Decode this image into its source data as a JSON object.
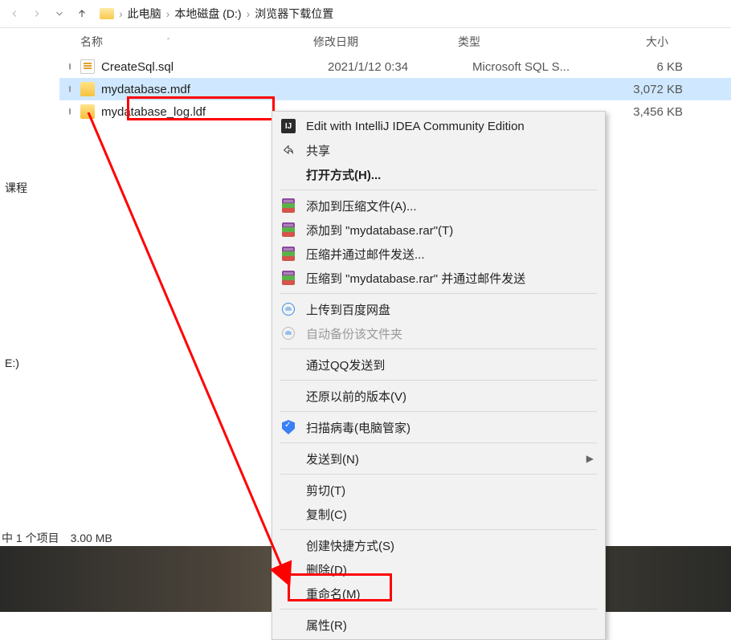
{
  "breadcrumb": [
    "此电脑",
    "本地磁盘 (D:)",
    "浏览器下载位置"
  ],
  "columns": {
    "name": "名称",
    "date": "修改日期",
    "type": "类型",
    "size": "大小"
  },
  "files": [
    {
      "name": "CreateSql.sql",
      "date": "2021/1/12 0:34",
      "type": "Microsoft SQL S...",
      "size": "6 KB",
      "icon": "sql",
      "pinned": true,
      "selected": false
    },
    {
      "name": "mydatabase.mdf",
      "date": "",
      "type": "",
      "size": "3,072 KB",
      "icon": "db",
      "pinned": true,
      "selected": true
    },
    {
      "name": "mydatabase_log.ldf",
      "date": "",
      "type": "",
      "size": "3,456 KB",
      "icon": "db",
      "pinned": true,
      "selected": false
    }
  ],
  "left_stubs": [
    "课程",
    "E:)"
  ],
  "status": "中 1 个项目　3.00 MB",
  "menu": {
    "edit_ij": "Edit with IntelliJ IDEA Community Edition",
    "share": "共享",
    "open_with": "打开方式(H)...",
    "rar_add": "添加到压缩文件(A)...",
    "rar_add_name": "添加到 \"mydatabase.rar\"(T)",
    "rar_email": "压缩并通过邮件发送...",
    "rar_email_name": "压缩到 \"mydatabase.rar\" 并通过邮件发送",
    "baidu_upload": "上传到百度网盘",
    "baidu_backup": "自动备份该文件夹",
    "qq_send": "通过QQ发送到",
    "restore": "还原以前的版本(V)",
    "scan": "扫描病毒(电脑管家)",
    "send_to": "发送到(N)",
    "cut": "剪切(T)",
    "copy": "复制(C)",
    "shortcut": "创建快捷方式(S)",
    "delete": "删除(D)",
    "rename": "重命名(M)",
    "properties": "属性(R)"
  }
}
